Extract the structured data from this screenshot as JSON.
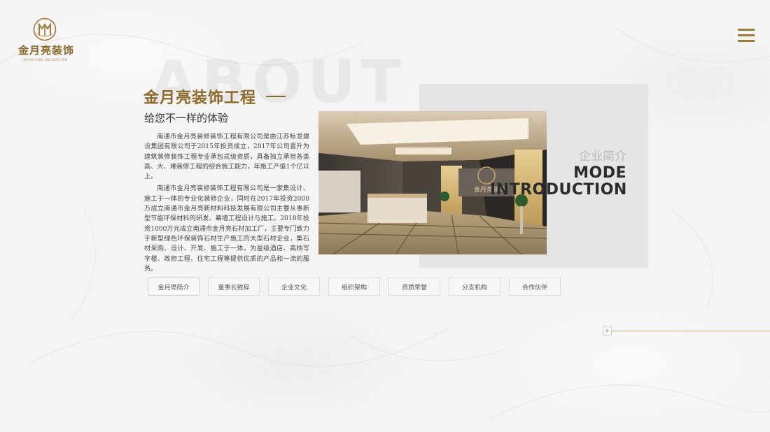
{
  "brand": {
    "name": "金月亮装饰",
    "subtitle": "JINYUELIANG DECORATION",
    "color": "#8c6a2b"
  },
  "watermark": "ABOUT",
  "heading": {
    "title": "金月亮装饰工程",
    "subtitle": "给您不一样的体验"
  },
  "intro": {
    "paragraphs": [
      "南通市金月亮装修装饰工程有限公司是由江苏标龙建设集团有限公司于2015年投资成立，2017年公司晋升为建筑装修装饰工程专业承包贰级资质，具备独立承担各类高、大、难装修工程的综合施工能力，年施工产值1个亿以上。",
      "南通市金月亮装修装饰工程有限公司是一家集设计、施工于一体的专业化装修企业，同时在2017年投资2000万成立南通市金月亮新材料科技发展有限公司主要从事新型节能环保材料的研发、幕墙工程设计与施工。2018年投资1000万元成立南通市金月亮石材加工厂，主要专门致力于新型绿色环保装饰石材生产施工的大型石材企业，集石材采购、设计、开发、施工于一体，为星级酒店、高档写字楼、政府工程、住宅工程等提供优质的产品和一流的服务。"
    ]
  },
  "panel": {
    "label": "企业简介",
    "mode_line1": "MODE",
    "mode_line2": "INTRODUCTION"
  },
  "tabs": [
    {
      "label": "金月亮简介"
    },
    {
      "label": "董事长致辞"
    },
    {
      "label": "企业文化"
    },
    {
      "label": "组织架构"
    },
    {
      "label": "资质荣誉"
    },
    {
      "label": "分支机构"
    },
    {
      "label": "合作伙伴"
    }
  ],
  "icons": {
    "menu": "hamburger-icon",
    "slider": "slider-handle-icon",
    "logo": "moon-logo-icon"
  }
}
